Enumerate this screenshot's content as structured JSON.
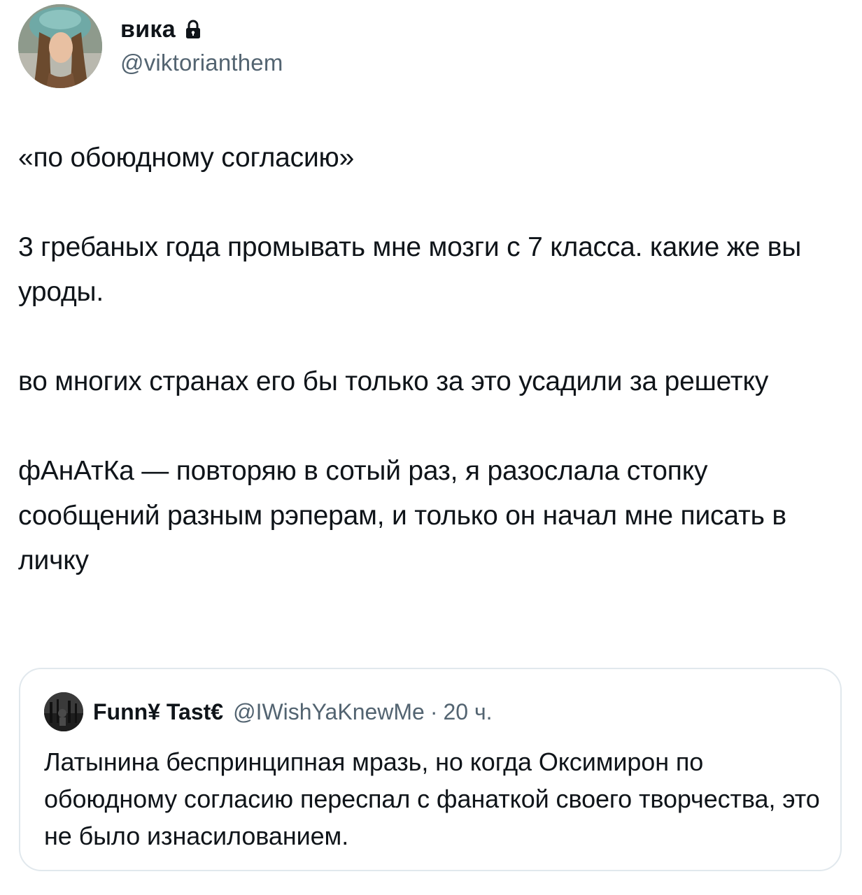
{
  "tweet": {
    "author": {
      "display_name": "вика",
      "handle": "@viktorianthem",
      "protected_icon": "lock-icon"
    },
    "paragraphs": [
      "«по обоюдному согласию»",
      "3 гребаных года промывать мне мозги с 7 класса. какие же вы уроды.",
      "во многих странах его бы только за это усадили за решетку",
      "фАнАтКа — повторяю в сотый раз, я разослала стопку сообщений разным рэперам, и только он начал мне писать в личку"
    ]
  },
  "quoted_tweet": {
    "author": {
      "display_name": "Funn¥ Tast€",
      "handle": "@IWishYaKnewMe",
      "separator": "·",
      "time": "20 ч."
    },
    "text": "Латынина беспринципная мразь, но когда Оксимирон по обоюдному согласию переспал с фанаткой своего творчества, это не было изнасилованием."
  },
  "colors": {
    "text": "#0f1419",
    "secondary": "#536471",
    "border": "#e1e8ed"
  }
}
